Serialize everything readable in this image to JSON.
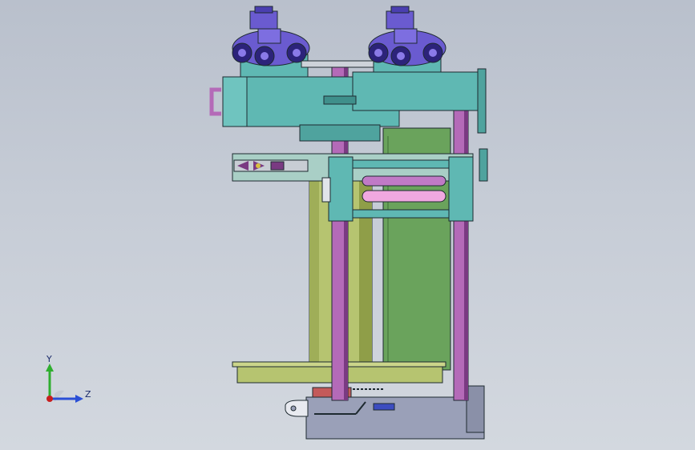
{
  "viewport": {
    "background_top": "#b9c0cc",
    "background_bottom": "#d3d8df"
  },
  "model": {
    "colors": {
      "teal_body": "#5fb8b3",
      "teal_dark": "#3f8f8b",
      "olive_drum": "#b6c470",
      "olive_dark": "#7f8f3e",
      "green_plate": "#6aa35c",
      "violet_rod": "#b46ab8",
      "violet_dark": "#7a3a82",
      "pink_roller": "#f0a8e0",
      "motor_blue": "#6a5bd0",
      "motor_dark": "#2c237a",
      "base_gray": "#9aa0b8",
      "outline": "#1e2a30"
    }
  },
  "triad": {
    "y_label": "Y",
    "z_label": "Z",
    "y_color": "#2fae2f",
    "z_color": "#2a4fd6",
    "x_color": "#c81e1e"
  }
}
